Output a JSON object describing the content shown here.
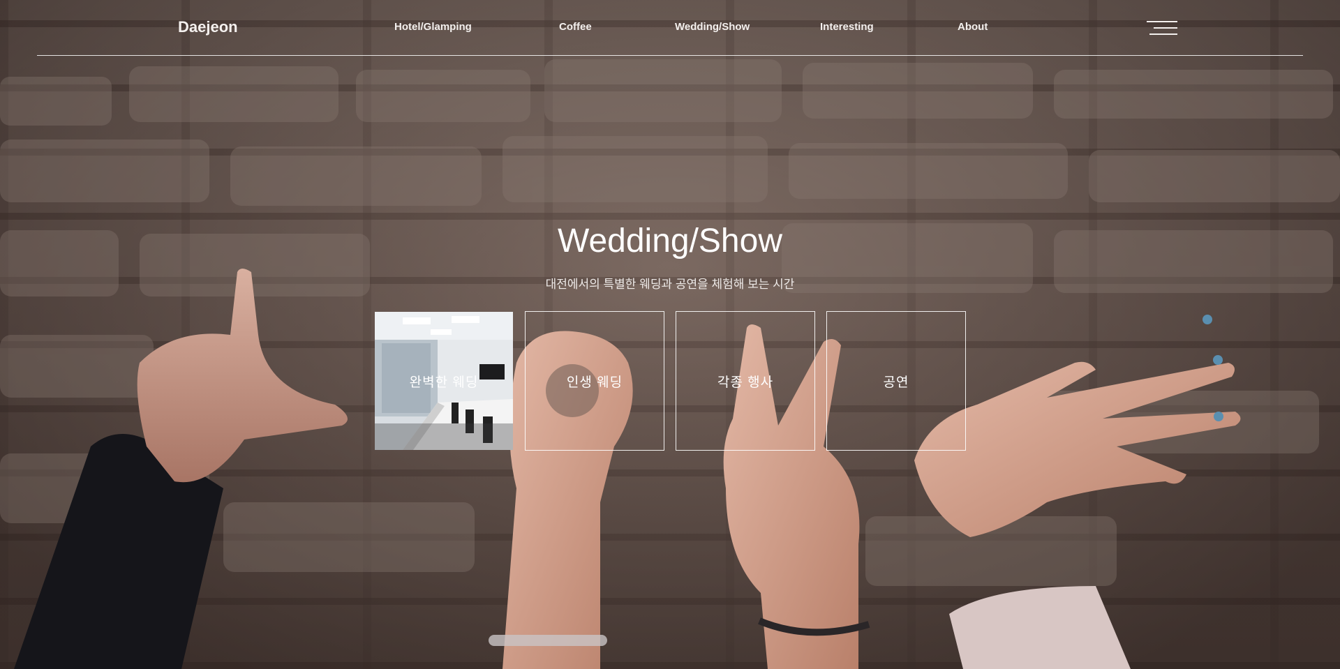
{
  "header": {
    "logo": "Daejeon",
    "nav": [
      {
        "label": "Hotel/Glamping"
      },
      {
        "label": "Coffee"
      },
      {
        "label": "Wedding/Show"
      },
      {
        "label": "Interesting"
      },
      {
        "label": "About"
      }
    ],
    "menu_icon": "hamburger-menu-icon"
  },
  "hero": {
    "title": "Wedding/Show",
    "subtitle": "대전에서의 특별한 웨딩과 공연을 체험해 보는 시간",
    "cards": [
      {
        "label": "완벽한 웨딩",
        "has_photo": true
      },
      {
        "label": "인생 웨딩"
      },
      {
        "label": "각종 행사"
      },
      {
        "label": "공연"
      }
    ]
  },
  "background": {
    "subject": "hands forming letters against a brick wall"
  }
}
